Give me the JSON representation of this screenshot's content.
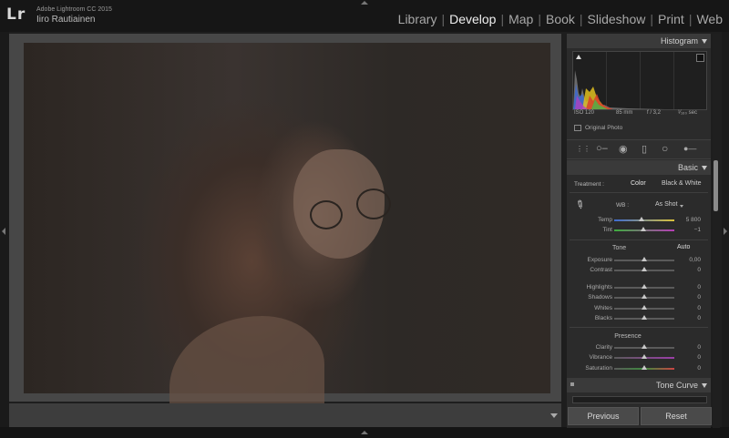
{
  "app": {
    "logo": "Lr",
    "product": "Adobe Lightroom CC 2015",
    "user": "Iiro Rautiainen"
  },
  "modules": [
    {
      "label": "Library",
      "active": false
    },
    {
      "label": "Develop",
      "active": true
    },
    {
      "label": "Map",
      "active": false
    },
    {
      "label": "Book",
      "active": false
    },
    {
      "label": "Slideshow",
      "active": false
    },
    {
      "label": "Print",
      "active": false
    },
    {
      "label": "Web",
      "active": false
    }
  ],
  "histogram": {
    "title": "Histogram",
    "iso": "ISO 120",
    "focal": "85 mm",
    "aperture": "f / 3,2",
    "shutter": "¹⁄₁₆₀ sec",
    "original_photo": "Original Photo"
  },
  "basic": {
    "title": "Basic",
    "treatment_label": "Treatment :",
    "treatment_color": "Color",
    "treatment_bw": "Black & White",
    "wb_label": "WB :",
    "wb_value": "As Shot",
    "temp_label": "Temp",
    "temp_value": "5 800",
    "temp_pos": 0.45,
    "tint_label": "Tint",
    "tint_value": "−1",
    "tint_pos": 0.49,
    "tone_label": "Tone",
    "auto_label": "Auto",
    "exposure_label": "Exposure",
    "exposure_value": "0,00",
    "contrast_label": "Contrast",
    "contrast_value": "0",
    "highlights_label": "Highlights",
    "highlights_value": "0",
    "shadows_label": "Shadows",
    "shadows_value": "0",
    "whites_label": "Whites",
    "whites_value": "0",
    "blacks_label": "Blacks",
    "blacks_value": "0",
    "presence_label": "Presence",
    "clarity_label": "Clarity",
    "clarity_value": "0",
    "vibrance_label": "Vibrance",
    "vibrance_value": "0",
    "saturation_label": "Saturation",
    "saturation_value": "0"
  },
  "tone_curve": {
    "title": "Tone Curve"
  },
  "buttons": {
    "previous": "Previous",
    "reset": "Reset"
  },
  "colors": {
    "active_module": "#f0f0f0",
    "panel": "#2b2b2b",
    "accent_bg": "#474747"
  }
}
